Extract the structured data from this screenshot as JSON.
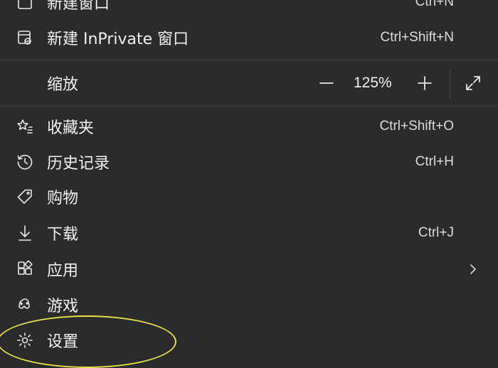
{
  "menu": {
    "new_window": {
      "label": "新建窗口",
      "shortcut": "Ctrl+N"
    },
    "new_inprivate": {
      "label": "新建 InPrivate 窗口",
      "shortcut": "Ctrl+Shift+N"
    },
    "zoom": {
      "label": "缩放",
      "value": "125%"
    },
    "favorites": {
      "label": "收藏夹",
      "shortcut": "Ctrl+Shift+O"
    },
    "history": {
      "label": "历史记录",
      "shortcut": "Ctrl+H"
    },
    "shopping": {
      "label": "购物"
    },
    "downloads": {
      "label": "下载",
      "shortcut": "Ctrl+J"
    },
    "apps": {
      "label": "应用"
    },
    "games": {
      "label": "游戏"
    },
    "settings": {
      "label": "设置"
    }
  },
  "icons": {
    "new_window": "window-icon",
    "new_inprivate": "inprivate-window-icon",
    "favorites": "star-list-icon",
    "history": "history-clock-icon",
    "shopping": "price-tag-icon",
    "downloads": "download-arrow-icon",
    "apps": "apps-grid-icon",
    "games": "gamepad-icon",
    "settings": "gear-icon"
  },
  "colors": {
    "background": "#2b2b2b",
    "text": "#f2f2f2",
    "highlight": "#e8e04a"
  }
}
